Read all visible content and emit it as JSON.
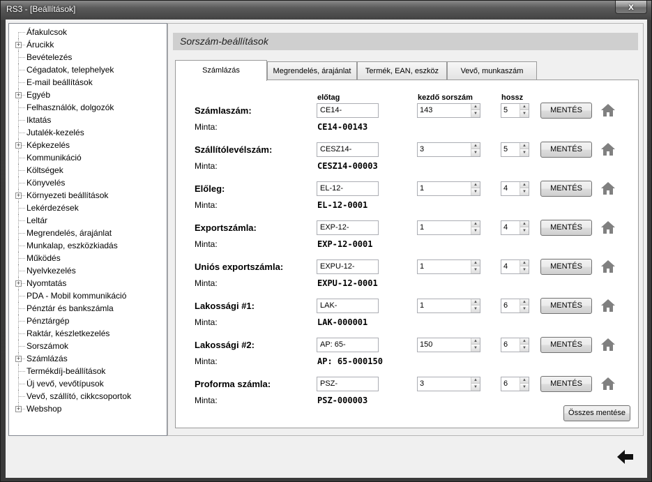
{
  "window": {
    "title": "RS3 - [Beállítások]",
    "close_label": "x"
  },
  "sidebar": {
    "items": [
      {
        "label": "Áfakulcsok",
        "expandable": false
      },
      {
        "label": "Árucikk",
        "expandable": true
      },
      {
        "label": "Bevételezés",
        "expandable": false
      },
      {
        "label": "Cégadatok, telephelyek",
        "expandable": false
      },
      {
        "label": "E-mail beállítások",
        "expandable": false
      },
      {
        "label": "Egyéb",
        "expandable": true
      },
      {
        "label": "Felhasználók, dolgozók",
        "expandable": false
      },
      {
        "label": "Iktatás",
        "expandable": false
      },
      {
        "label": "Jutalék-kezelés",
        "expandable": false
      },
      {
        "label": "Képkezelés",
        "expandable": true
      },
      {
        "label": "Kommunikáció",
        "expandable": false
      },
      {
        "label": "Költségek",
        "expandable": false
      },
      {
        "label": "Könyvelés",
        "expandable": false
      },
      {
        "label": "Környezeti beállítások",
        "expandable": true
      },
      {
        "label": "Lekérdezések",
        "expandable": false
      },
      {
        "label": "Leltár",
        "expandable": false
      },
      {
        "label": "Megrendelés, árajánlat",
        "expandable": false
      },
      {
        "label": "Munkalap, eszközkiadás",
        "expandable": false
      },
      {
        "label": "Működés",
        "expandable": false
      },
      {
        "label": "Nyelvkezelés",
        "expandable": false
      },
      {
        "label": "Nyomtatás",
        "expandable": true
      },
      {
        "label": "PDA - Mobil kommunikáció",
        "expandable": false
      },
      {
        "label": "Pénztár és bankszámla",
        "expandable": false
      },
      {
        "label": "Pénztárgép",
        "expandable": false
      },
      {
        "label": "Raktár, készletkezelés",
        "expandable": false
      },
      {
        "label": "Sorszámok",
        "expandable": false
      },
      {
        "label": "Számlázás",
        "expandable": true
      },
      {
        "label": "Termékdíj-beállítások",
        "expandable": false
      },
      {
        "label": "Új vevő, vevőtípusok",
        "expandable": false
      },
      {
        "label": "Vevő, szállító, cikkcsoportok",
        "expandable": false
      },
      {
        "label": "Webshop",
        "expandable": true
      }
    ]
  },
  "panel": {
    "title": "Sorszám-beállítások",
    "tabs": [
      {
        "label": "Számlázás",
        "active": true
      },
      {
        "label": "Megrendelés, árajánlat",
        "active": false
      },
      {
        "label": "Termék, EAN, eszköz",
        "active": false
      },
      {
        "label": "Vevő, munkaszám",
        "active": false
      }
    ],
    "columns": {
      "prefix": "előtag",
      "start": "kezdő sorszám",
      "length": "hossz"
    },
    "minta_label": "Minta:",
    "save_label": "MENTÉS",
    "save_all_label": "Összes mentése",
    "rows": [
      {
        "label": "Számlaszám:",
        "prefix": "CE14-",
        "start": "143",
        "length": "5",
        "sample": "CE14-00143"
      },
      {
        "label": "Szállítólevélszám:",
        "prefix": "CESZ14-",
        "start": "3",
        "length": "5",
        "sample": "CESZ14-00003"
      },
      {
        "label": "Előleg:",
        "prefix": "EL-12-",
        "start": "1",
        "length": "4",
        "sample": "EL-12-0001"
      },
      {
        "label": "Exportszámla:",
        "prefix": "EXP-12-",
        "start": "1",
        "length": "4",
        "sample": "EXP-12-0001"
      },
      {
        "label": "Uniós exportszámla:",
        "prefix": "EXPU-12-",
        "start": "1",
        "length": "4",
        "sample": "EXPU-12-0001"
      },
      {
        "label": "Lakossági #1:",
        "prefix": "LAK-",
        "start": "1",
        "length": "6",
        "sample": "LAK-000001"
      },
      {
        "label": "Lakossági #2:",
        "prefix": "AP: 65-",
        "start": "150",
        "length": "6",
        "sample": "AP: 65-000150"
      },
      {
        "label": "Proforma számla:",
        "prefix": "PSZ-",
        "start": "3",
        "length": "6",
        "sample": "PSZ-000003"
      }
    ]
  },
  "icons": {
    "row_default": "home-icon",
    "back": "back-arrow-icon"
  },
  "colors": {
    "header_bg": "#cfcfcf",
    "icon_gray": "#808080"
  }
}
